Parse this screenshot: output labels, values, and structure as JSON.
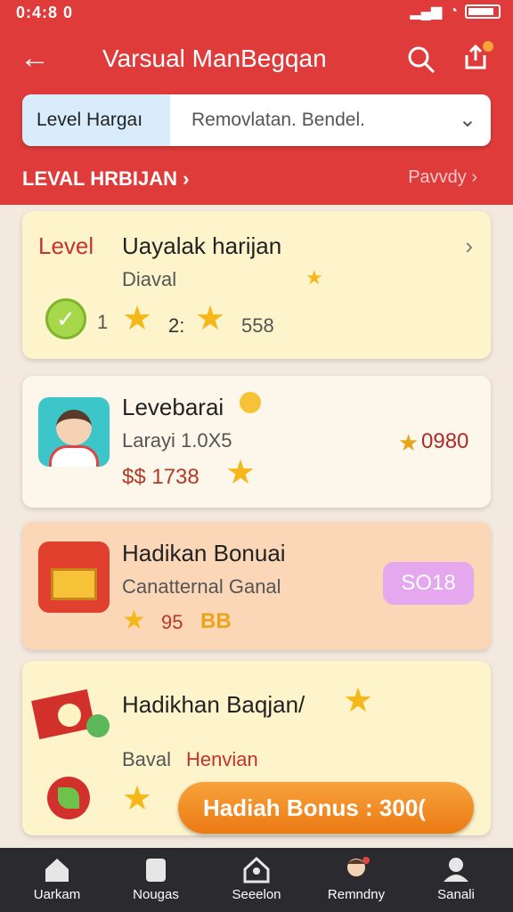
{
  "status": {
    "time": "0:4:8 0"
  },
  "header": {
    "title": "Varsual ManBegqan",
    "segment": {
      "left": "Level Hargaı",
      "right": "Removlatan.  Bendel."
    },
    "section": {
      "left": "LEVAL HRBIJAN",
      "right": "Pavvdy"
    }
  },
  "cards": [
    {
      "label": "Level",
      "title": "Uayalak harijan",
      "subtitle": "Diaval",
      "stats": {
        "n1": "1",
        "n2": "2:",
        "n3": "558"
      }
    },
    {
      "title": "Levebarai",
      "subtitle": "Larayi 1.0X5",
      "price": "$$ 1738",
      "score": "0980"
    },
    {
      "title": "Hadikan Bonuai",
      "subtitle": "Canatternal Ganal",
      "count": "95",
      "badge": "BB",
      "pill": "SO18"
    },
    {
      "title": "Hadikhan Baqjan/",
      "subtitle1": "Baval",
      "subtitle2": "Henvian"
    }
  ],
  "bonus_button": "Hadiah Bonus : 300(",
  "nav": [
    {
      "label": "Uarkam",
      "icon": "home-icon"
    },
    {
      "label": "Nougas",
      "icon": "card-icon"
    },
    {
      "label": "Seeelon",
      "icon": "house-icon"
    },
    {
      "label": "Remndny",
      "icon": "avatar-icon"
    },
    {
      "label": "Sanali",
      "icon": "user-icon"
    }
  ],
  "colors": {
    "brand": "#df3b3b",
    "accent": "#f5b818",
    "button": "#ec7a14"
  }
}
